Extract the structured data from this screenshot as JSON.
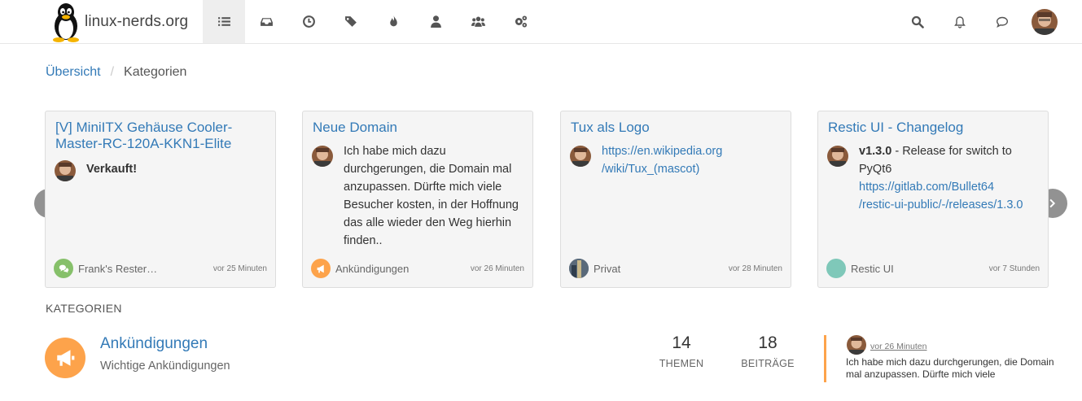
{
  "brand": {
    "name": "linux-nerds.org"
  },
  "nav": {
    "items": [
      {
        "name": "categories",
        "icon": "list-icon",
        "active": true
      },
      {
        "name": "recent",
        "icon": "inbox-icon"
      },
      {
        "name": "unread",
        "icon": "clock-icon"
      },
      {
        "name": "tags",
        "icon": "tags-icon"
      },
      {
        "name": "popular",
        "icon": "fire-icon"
      },
      {
        "name": "users",
        "icon": "user-icon"
      },
      {
        "name": "groups",
        "icon": "users-icon"
      },
      {
        "name": "admin",
        "icon": "cogs-icon"
      }
    ],
    "right": [
      "search-icon",
      "bell-icon",
      "chat-icon",
      "avatar"
    ]
  },
  "breadcrumb": {
    "home": "Übersicht",
    "current": "Kategorien"
  },
  "cards": [
    {
      "title": "[V] MiniITX Gehäuse Cooler-Master-RC-120A-KKN1-Elite",
      "body_bold": "Verkauft!",
      "category": "Frank's Rester…",
      "category_color": "#86c06a",
      "time": "vor 25 Minuten"
    },
    {
      "title": "Neue Domain",
      "body": "Ich habe mich dazu durchgerungen, die Domain mal anzupassen. Dürfte mich viele Besucher kosten, in der Hoffnung das alle wieder den Weg hierhin finden..",
      "category": "Ankündigungen",
      "category_color": "#fda34b",
      "time": "vor 26 Minuten"
    },
    {
      "title": "Tux als Logo",
      "link_line1": "https://en.wikipedia.org",
      "link_line2": "/wiki/Tux_(mascot)",
      "category": "Privat",
      "category_color": "#6b7b8c",
      "time": "vor 28 Minuten"
    },
    {
      "title": "Restic UI - Changelog",
      "body_bold": "v1.3.0",
      "body_rest": " - Release for switch to PyQt6",
      "link_line1": "https://gitlab.com/Bullet64",
      "link_line2": "/restic-ui-public/-/releases/1.3.0",
      "category": "Restic UI",
      "category_color": "#7fc8b9",
      "time": "vor 7 Stunden"
    }
  ],
  "categories_section": {
    "label": "KATEGORIEN",
    "rows": [
      {
        "title": "Ankündigungen",
        "description": "Wichtige Ankündigungen",
        "color": "#fda34b",
        "topics": "14",
        "topics_label": "THEMEN",
        "posts": "18",
        "posts_label": "BEITRÄGE",
        "teaser_time": "vor 26 Minuten",
        "teaser_text": "Ich habe mich dazu durchgerungen, die Domain mal anzupassen. Dürfte mich viele"
      }
    ]
  }
}
